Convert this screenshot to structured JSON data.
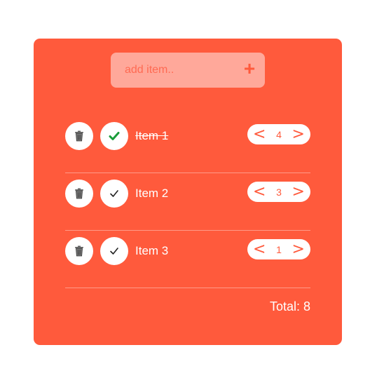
{
  "input": {
    "placeholder": "add item..",
    "add_label": "+"
  },
  "items": [
    {
      "name": "Item 1",
      "quantity": "4",
      "completed": true
    },
    {
      "name": "Item 2",
      "quantity": "3",
      "completed": false
    },
    {
      "name": "Item 3",
      "quantity": "1",
      "completed": false
    }
  ],
  "arrows": {
    "decrease": "<",
    "increase": ">"
  },
  "total": {
    "label": "Total: 8"
  },
  "icons": {
    "delete": "trash-icon",
    "toggle": "check-icon"
  },
  "colors": {
    "card": "#ff5a3c",
    "input_bg": "#ffa89a",
    "check_done": "#1a9c3a",
    "check_todo": "#222222"
  }
}
